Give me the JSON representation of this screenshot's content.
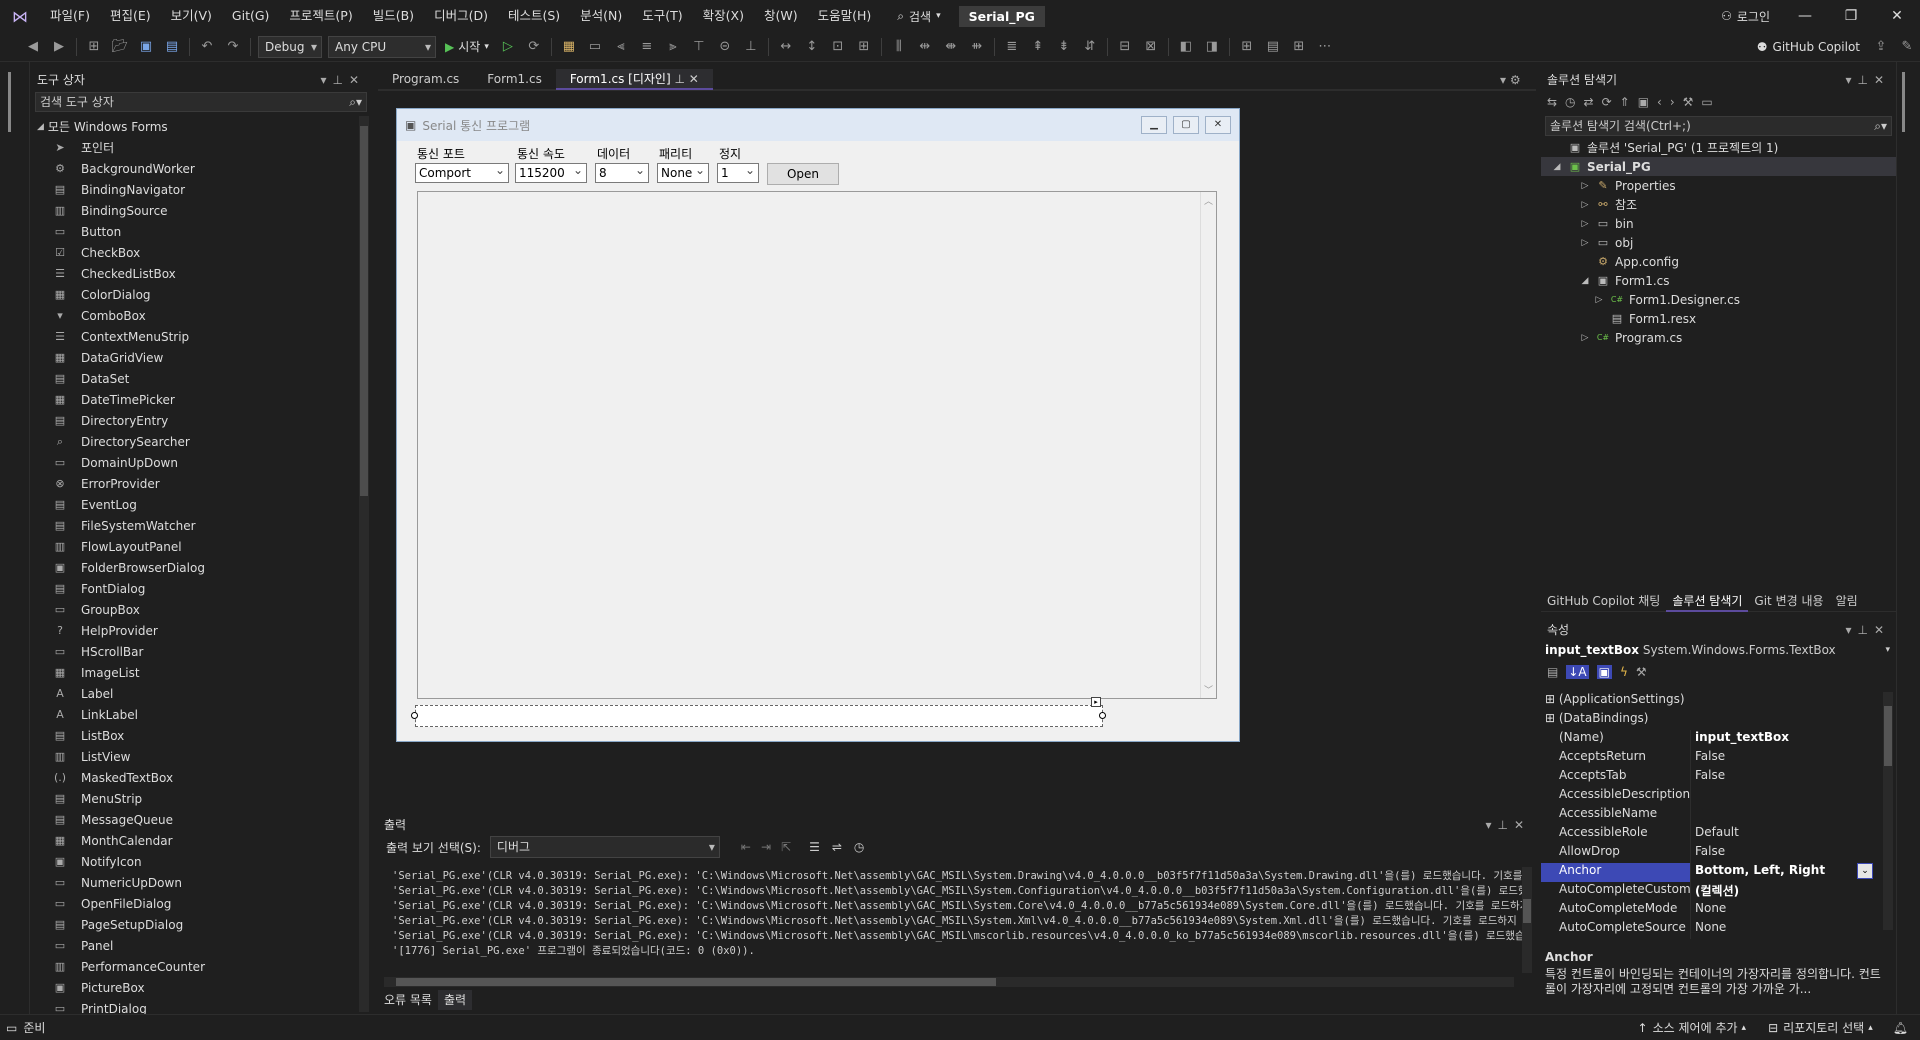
{
  "menubar": {
    "items": [
      "파일(F)",
      "편집(E)",
      "보기(V)",
      "Git(G)",
      "프로젝트(P)",
      "빌드(B)",
      "디버그(D)",
      "테스트(S)",
      "분석(N)",
      "도구(T)",
      "확장(X)",
      "창(W)",
      "도움말(H)"
    ],
    "search": "검색",
    "solution_name": "Serial_PG",
    "login": "로그인"
  },
  "toolbar": {
    "config": "Debug",
    "platform": "Any CPU",
    "start": "시작",
    "copilot": "GitHub Copilot"
  },
  "toolbox": {
    "title": "도구 상자",
    "search_placeholder": "검색 도구 상자",
    "group": "모든 Windows Forms",
    "items": [
      "포인터",
      "BackgroundWorker",
      "BindingNavigator",
      "BindingSource",
      "Button",
      "CheckBox",
      "CheckedListBox",
      "ColorDialog",
      "ComboBox",
      "ContextMenuStrip",
      "DataGridView",
      "DataSet",
      "DateTimePicker",
      "DirectoryEntry",
      "DirectorySearcher",
      "DomainUpDown",
      "ErrorProvider",
      "EventLog",
      "FileSystemWatcher",
      "FlowLayoutPanel",
      "FolderBrowserDialog",
      "FontDialog",
      "GroupBox",
      "HelpProvider",
      "HScrollBar",
      "ImageList",
      "Label",
      "LinkLabel",
      "ListBox",
      "ListView",
      "MaskedTextBox",
      "MenuStrip",
      "MessageQueue",
      "MonthCalendar",
      "NotifyIcon",
      "NumericUpDown",
      "OpenFileDialog",
      "PageSetupDialog",
      "Panel",
      "PerformanceCounter",
      "PictureBox",
      "PrintDialog"
    ]
  },
  "editor_tabs": [
    {
      "label": "Program.cs",
      "active": false
    },
    {
      "label": "Form1.cs",
      "active": false
    },
    {
      "label": "Form1.cs [디자인]",
      "active": true
    }
  ],
  "form": {
    "title": "Serial 통신 프로그램",
    "labels": {
      "port": "통신 포트",
      "speed": "통신 속도",
      "data": "데이터",
      "parity": "패리티",
      "stop": "정지"
    },
    "values": {
      "port": "Comport",
      "speed": "115200",
      "data": "8",
      "parity": "None",
      "stop": "1"
    },
    "open_button": "Open"
  },
  "output": {
    "title": "출력",
    "source_label": "출력 보기 선택(S):",
    "source_value": "디버그",
    "lines": [
      "'Serial_PG.exe'(CLR v4.0.30319: Serial_PG.exe): 'C:\\Windows\\Microsoft.Net\\assembly\\GAC_MSIL\\System.Drawing\\v4.0_4.0.0.0__b03f5f7f11d50a3a\\System.Drawing.dll'을(를) 로드했습니다. 기호를 로",
      "'Serial_PG.exe'(CLR v4.0.30319: Serial_PG.exe): 'C:\\Windows\\Microsoft.Net\\assembly\\GAC_MSIL\\System.Configuration\\v4.0_4.0.0.0__b03f5f7f11d50a3a\\System.Configuration.dll'을(를) 로드했습니다",
      "'Serial_PG.exe'(CLR v4.0.30319: Serial_PG.exe): 'C:\\Windows\\Microsoft.Net\\assembly\\GAC_MSIL\\System.Core\\v4.0_4.0.0.0__b77a5c561934e089\\System.Core.dll'을(를) 로드했습니다. 기호를 로드하지",
      "'Serial_PG.exe'(CLR v4.0.30319: Serial_PG.exe): 'C:\\Windows\\Microsoft.Net\\assembly\\GAC_MSIL\\System.Xml\\v4.0_4.0.0.0__b77a5c561934e089\\System.Xml.dll'을(를) 로드했습니다. 기호를 로드하지 않",
      "'Serial_PG.exe'(CLR v4.0.30319: Serial_PG.exe): 'C:\\Windows\\Microsoft.Net\\assembly\\GAC_MSIL\\mscorlib.resources\\v4.0_4.0.0.0_ko_b77a5c561934e089\\mscorlib.resources.dll'을(를) 로드했습니다.",
      "'[1776] Serial_PG.exe' 프로그램이 종료되었습니다(코드: 0 (0x0))."
    ],
    "tabs": [
      "오류 목록",
      "출력"
    ]
  },
  "solution_explorer": {
    "title": "솔루션 탐색기",
    "search_placeholder": "솔루션 탐색기 검색(Ctrl+;)",
    "solution": "솔루션 'Serial_PG' (1 프로젝트의 1)",
    "project": "Serial_PG",
    "nodes": [
      {
        "label": "Properties",
        "indent": 2,
        "exp": "▷",
        "icon": "wrench-icon"
      },
      {
        "label": "참조",
        "indent": 2,
        "exp": "▷",
        "icon": "references-icon"
      },
      {
        "label": "bin",
        "indent": 2,
        "exp": "▷",
        "icon": "folder-icon"
      },
      {
        "label": "obj",
        "indent": 2,
        "exp": "▷",
        "icon": "folder-icon"
      },
      {
        "label": "App.config",
        "indent": 2,
        "exp": "",
        "icon": "config-icon"
      },
      {
        "label": "Form1.cs",
        "indent": 2,
        "exp": "◢",
        "icon": "form-icon"
      },
      {
        "label": "Form1.Designer.cs",
        "indent": 3,
        "exp": "▷",
        "icon": "cs-file-icon"
      },
      {
        "label": "Form1.resx",
        "indent": 3,
        "exp": "",
        "icon": "resx-icon"
      },
      {
        "label": "Program.cs",
        "indent": 2,
        "exp": "▷",
        "icon": "cs-file-icon"
      }
    ],
    "bottom_tabs": [
      "GitHub Copilot 채팅",
      "솔루션 탐색기",
      "Git 변경 내용",
      "알림"
    ]
  },
  "properties": {
    "title": "속성",
    "object_name": "input_textBox",
    "object_type": "System.Windows.Forms.TextBox",
    "rows": [
      {
        "name": "(ApplicationSettings)",
        "value": "",
        "category": true
      },
      {
        "name": "(DataBindings)",
        "value": "",
        "category": true
      },
      {
        "name": "(Name)",
        "value": "input_textBox",
        "bold": true
      },
      {
        "name": "AcceptsReturn",
        "value": "False"
      },
      {
        "name": "AcceptsTab",
        "value": "False"
      },
      {
        "name": "AccessibleDescription",
        "value": ""
      },
      {
        "name": "AccessibleName",
        "value": ""
      },
      {
        "name": "AccessibleRole",
        "value": "Default"
      },
      {
        "name": "AllowDrop",
        "value": "False"
      },
      {
        "name": "Anchor",
        "value": "Bottom, Left, Right",
        "selected": true,
        "bold": true
      },
      {
        "name": "AutoCompleteCustomSource",
        "value": "(컬렉션)",
        "bold": true
      },
      {
        "name": "AutoCompleteMode",
        "value": "None"
      },
      {
        "name": "AutoCompleteSource",
        "value": "None"
      }
    ],
    "desc_title": "Anchor",
    "desc_text": "특정 컨트롤이 바인딩되는 컨테이너의 가장자리를 정의합니다. 컨트롤이 가장자리에 고정되면 컨트롤의 가장 가까운 가..."
  },
  "statusbar": {
    "ready": "준비",
    "source_control": "소스 제어에 추가",
    "repo": "리포지토리 선택"
  }
}
